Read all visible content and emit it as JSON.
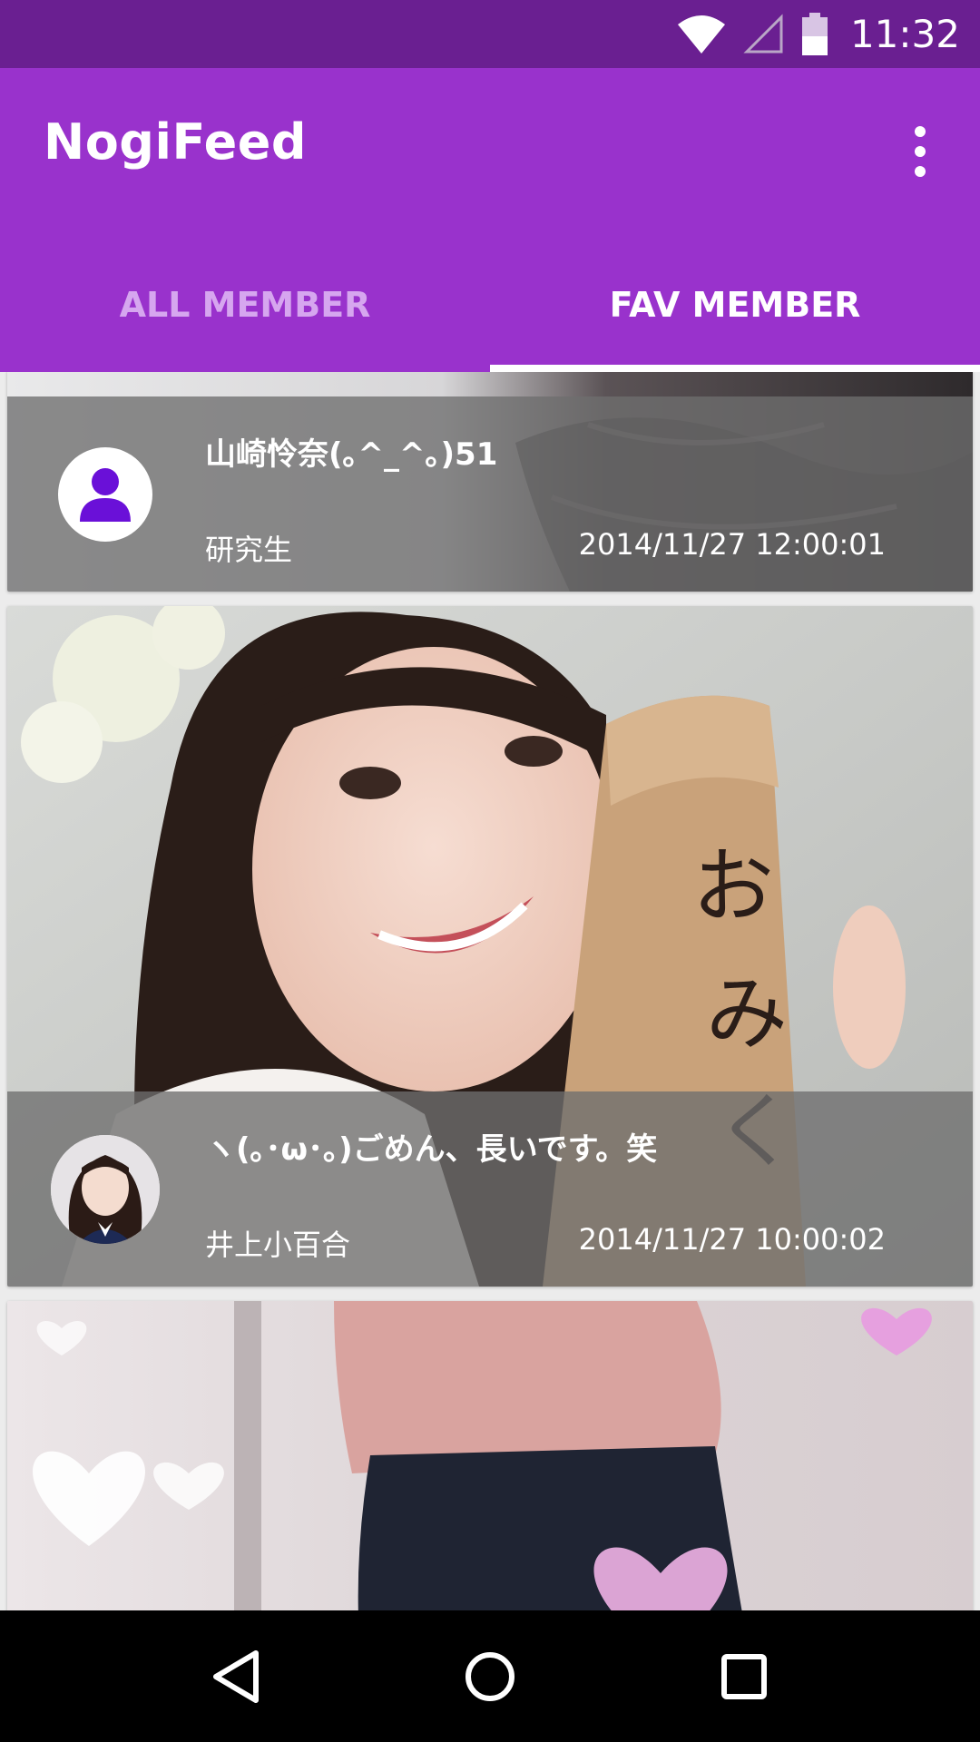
{
  "status_bar": {
    "time": "11:32",
    "icons": [
      "wifi-icon",
      "signal-icon",
      "battery-icon"
    ]
  },
  "app_bar": {
    "title": "NogiFeed",
    "overflow_icon": "more-vert-icon",
    "color": "#9932cc"
  },
  "tabs": [
    {
      "label": "ALL MEMBER",
      "selected": false
    },
    {
      "label": "FAV MEMBER",
      "selected": true
    }
  ],
  "feed": [
    {
      "title": "山崎怜奈(｡^_^｡)51",
      "author": "研究生",
      "date": "2014/11/27 12:00:01",
      "avatar": "default-person-icon"
    },
    {
      "title": "ヽ(｡･ω･｡)ごめん、長いです。笑",
      "author": "井上小百合",
      "date": "2014/11/27 10:00:02",
      "avatar": "member-portrait"
    },
    {
      "title": "",
      "author": "",
      "date": "",
      "avatar": ""
    }
  ],
  "nav_bar": {
    "buttons": [
      "back-icon",
      "home-icon",
      "recents-icon"
    ]
  },
  "colors": {
    "status_bar": "#6a1f91",
    "app_bar": "#9932cc",
    "tab_inactive": "#d6a6ef",
    "tab_active": "#ffffff",
    "overlay": "#6e6e6e"
  }
}
